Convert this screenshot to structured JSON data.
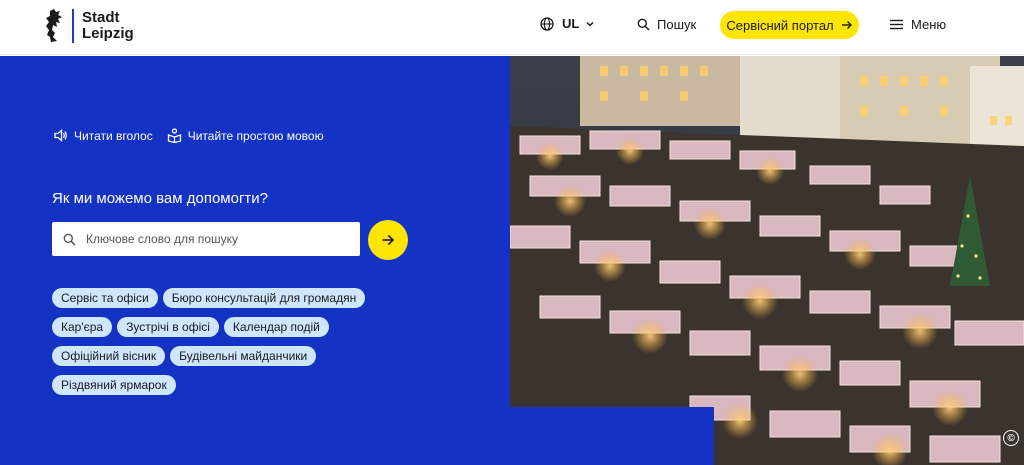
{
  "header": {
    "logo": {
      "line1": "Stadt",
      "line2": "Leipzig"
    },
    "language": {
      "code": "UL",
      "icon": "globe-icon"
    },
    "search_label": "Пошук",
    "portal_label": "Сервісний портал",
    "menu_label": "Меню"
  },
  "hero": {
    "read_aloud": "Читати вголос",
    "simple_language": "Читайте простою мовою",
    "help_title": "Як ми можемо вам допомогти?",
    "search_placeholder": "Ключове слово для пошуку",
    "copyright_symbol": "©",
    "chips": [
      "Сервіс та офіси",
      "Бюро консультацій для громадян",
      "Кар'єра",
      "Зустрічі в офісі",
      "Календар подій",
      "Офіційний вісник",
      "Будівельні майданчики",
      "Різдвяний ярмарок"
    ]
  },
  "colors": {
    "brand_blue": "#1432c4",
    "accent_yellow": "#ffe600",
    "chip_bg": "#cfe6ff"
  }
}
